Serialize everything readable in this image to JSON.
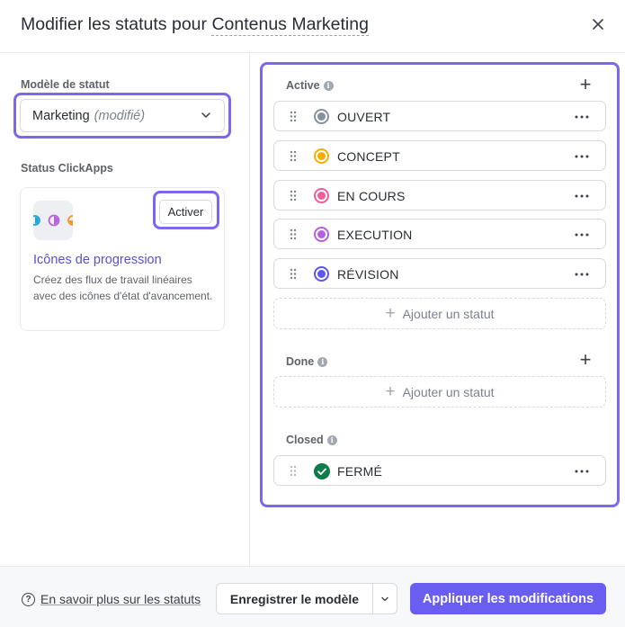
{
  "header": {
    "title_prefix": "Modifier les statuts pour",
    "project_name": "Contenus Marketing"
  },
  "left": {
    "template_label": "Modèle de statut",
    "template_value": "Marketing",
    "template_modifier": "(modifié)",
    "clickapps_label": "Status ClickApps",
    "card": {
      "activate_label": "Activer",
      "title": "Icônes de progression",
      "description": "Créez des flux de travail linéaires avec des icônes d'état d'avancement."
    }
  },
  "groups": {
    "active": {
      "label": "Active",
      "statuses": [
        {
          "name": "OUVERT",
          "color": "#87909e"
        },
        {
          "name": "CONCEPT",
          "color": "#f8ae00"
        },
        {
          "name": "EN COURS",
          "color": "#ee5e99"
        },
        {
          "name": "EXECUTION",
          "color": "#b660e0"
        },
        {
          "name": "RÉVISION",
          "color": "#5f55ee"
        }
      ],
      "add_label": "Ajouter un statut"
    },
    "done": {
      "label": "Done",
      "add_label": "Ajouter un statut"
    },
    "closed": {
      "label": "Closed",
      "statuses": [
        {
          "name": "FERMÉ",
          "color": "#0f7b4a"
        }
      ]
    }
  },
  "footer": {
    "help_label": "En savoir plus sur les statuts",
    "save_template_label": "Enregistrer le modèle",
    "apply_label": "Appliquer les modifications"
  },
  "colors": {
    "accent": "#7b68ee",
    "apply_bg": "#6a5ef0",
    "link": "#5b4fcf"
  }
}
